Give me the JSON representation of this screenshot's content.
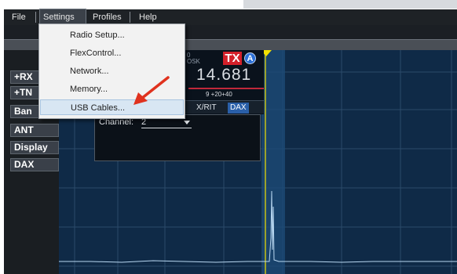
{
  "menubar": {
    "items": [
      {
        "label": "File"
      },
      {
        "label": "Settings"
      },
      {
        "label": "Profiles"
      },
      {
        "label": "Help"
      }
    ]
  },
  "settings_menu": {
    "items": [
      {
        "label": "Radio Setup..."
      },
      {
        "label": "FlexControl..."
      },
      {
        "label": "Network..."
      },
      {
        "label": "Memory..."
      },
      {
        "label": "USB Cables..."
      }
    ],
    "highlighted_index": 4
  },
  "side_panel": {
    "buttons": [
      {
        "label": "+RX"
      },
      {
        "label": "+TN"
      },
      {
        "label": "Ban"
      },
      {
        "label": "ANT"
      },
      {
        "label": "Display"
      },
      {
        "label": "DAX"
      }
    ]
  },
  "slice": {
    "frequency": "14.681",
    "tx_badge": "TX",
    "slice_letter": "A",
    "scale_text": "9 +20+40",
    "mode_text": "0\nOSK",
    "tabs": [
      {
        "label": "X/RIT"
      },
      {
        "label": "DAX"
      }
    ],
    "dax": {
      "channel_label": "Channel:",
      "channel_value": "2"
    }
  },
  "colors": {
    "panadapter_bg": "#0f2a47",
    "tx_red": "#d4202a",
    "slice_blue": "#2b6fd6",
    "marker_yellow": "#f2e100",
    "arrow_red": "#e0321e"
  },
  "icons": [
    "dropdown-chevron-icon",
    "slice-marker-icon",
    "annotation-arrow-icon"
  ]
}
